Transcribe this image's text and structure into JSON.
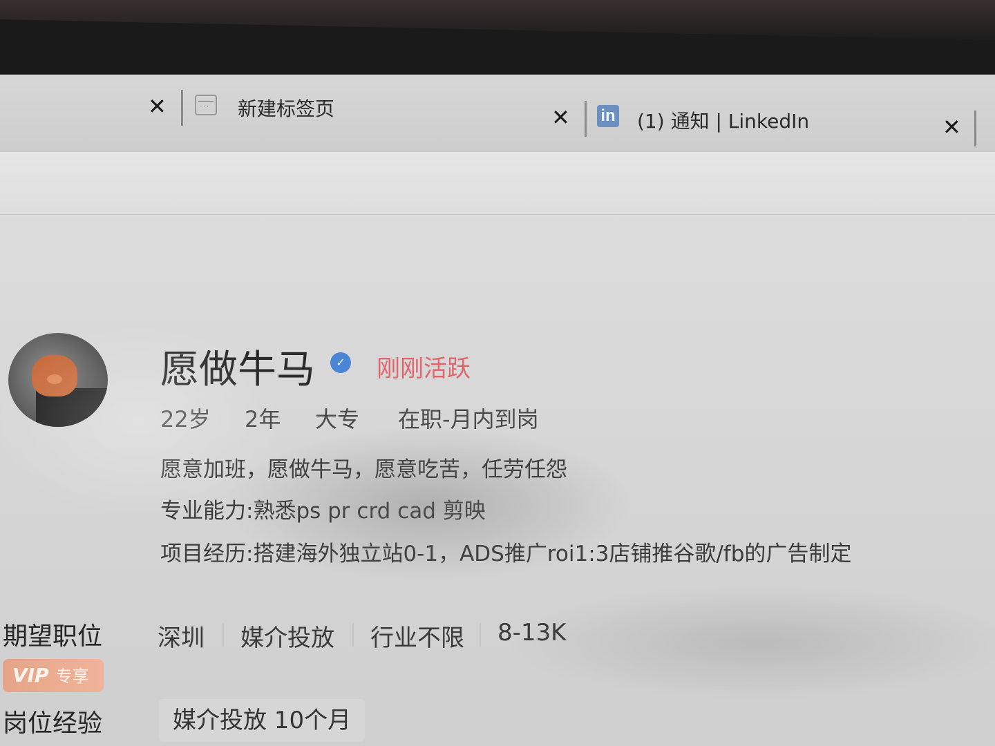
{
  "tabs": [
    {
      "title": "",
      "close_glyph": "✕"
    },
    {
      "title": "新建标签页",
      "icon": "new-tab-icon",
      "close_glyph": "✕"
    },
    {
      "title": "(1) 通知 | LinkedIn",
      "icon": "linkedin-icon",
      "icon_text": "in",
      "close_glyph": "✕"
    }
  ],
  "profile": {
    "name": "愿做牛马",
    "verified_glyph": "✓",
    "active_status": "刚刚活跃",
    "meta": {
      "age": "22岁",
      "experience": "2年",
      "education": "大专",
      "status": "在职-月内到岗"
    },
    "description": [
      "愿意加班，愿做牛马，愿意吃苦，任劳任怨",
      "专业能力:熟悉ps pr crd cad 剪映",
      "项目经历:搭建海外独立站0-1，ADS推广roi1:3店铺推谷歌/fb的广告制定"
    ]
  },
  "expectation": {
    "label": "期望职位",
    "city": "深圳",
    "position": "媒介投放",
    "industry": "行业不限",
    "salary": "8-13K"
  },
  "vip": {
    "vip_text": "VIP",
    "exclusive": "专享"
  },
  "position_experience": {
    "label": "岗位经验",
    "chip": "媒介投放 10个月"
  },
  "colors": {
    "active": "#e0656a",
    "verified": "#4b86d6",
    "vip": "#e6a487"
  }
}
